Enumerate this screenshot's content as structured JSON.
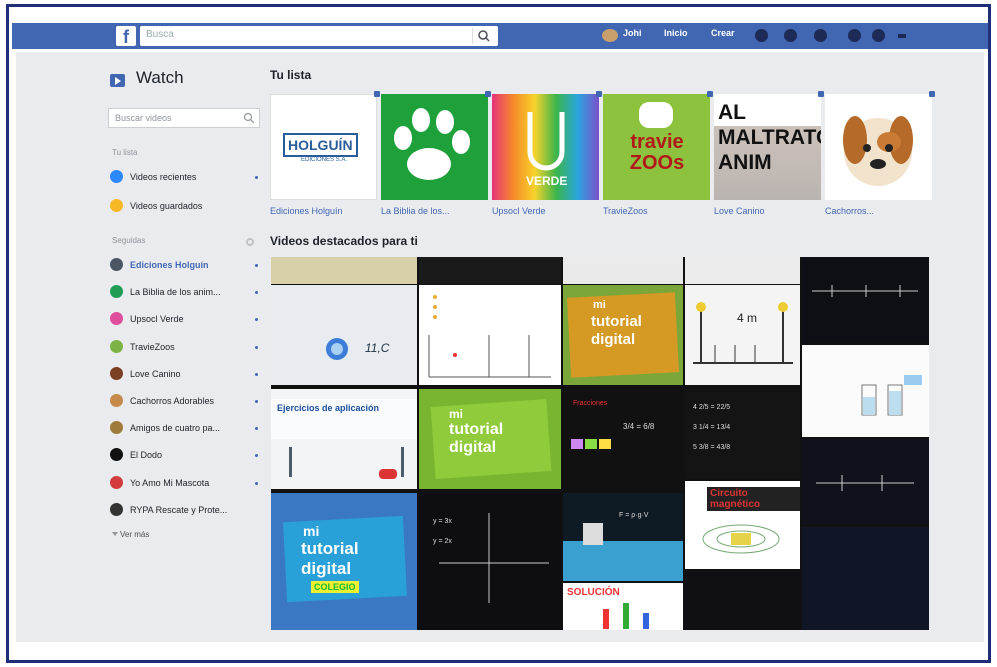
{
  "topbar": {
    "logo": "f",
    "search_placeholder": "Busca",
    "user": "Johi",
    "home": "Inicio",
    "create": "Crear"
  },
  "sidebar": {
    "title": "Watch",
    "search_placeholder": "Buscar videos",
    "tu_lista_label": "Tu lista",
    "tu_lista_items": [
      {
        "label": "Videos recientes",
        "color": "#2d88ff"
      },
      {
        "label": "Videos guardados",
        "color": "#f7b928"
      }
    ],
    "seguidas_label": "Seguidas",
    "followed": [
      {
        "label": "Ediciones Holguín",
        "color": "#4b5563",
        "selected": true
      },
      {
        "label": "La Biblia de los anim...",
        "color": "#1f9d55"
      },
      {
        "label": "Upsocl Verde",
        "color": "#e04f9b"
      },
      {
        "label": "TravieZoos",
        "color": "#7cb342"
      },
      {
        "label": "Love Canino",
        "color": "#7b3f22"
      },
      {
        "label": "Cachorros Adorables",
        "color": "#c58a4a"
      },
      {
        "label": "Amigos de cuatro pa...",
        "color": "#a07a3a"
      },
      {
        "label": "El Dodo",
        "color": "#111111"
      },
      {
        "label": "Yo Amo Mi Mascota",
        "color": "#d23c3c"
      },
      {
        "label": "RYPA Rescate y Prote...",
        "color": "#333333"
      }
    ],
    "more": "Ver más"
  },
  "main": {
    "list_title": "Tu lista",
    "channels": [
      {
        "label": "Ediciones Holguín",
        "logo_text": "HOLGUÍN",
        "sub_text": "EDICIONES S.A.",
        "bg": "#ffffff"
      },
      {
        "label": "La Biblia de los...",
        "logo_text": "",
        "bg": "#1ea03a"
      },
      {
        "label": "Upsocl Verde",
        "logo_text": "VERDE",
        "bg": "#f58a2a"
      },
      {
        "label": "TravieZoos",
        "logo_text": "travie ZOOs",
        "bg": "#8dc23f"
      },
      {
        "label": "Love Canino",
        "logo_text": "AL MALTRATO ANIM",
        "bg": "#ffffff"
      },
      {
        "label": "Cachorros...",
        "logo_text": "",
        "bg": "#ffffff"
      }
    ],
    "featured_title": "Videos destacados para ti",
    "featured_texts": {
      "temp": "11,C",
      "four_m": "4 m",
      "aplic": "Ejercicios de aplicación",
      "circuito": "Circuito magnético",
      "solucion": "SOLUCIÓN",
      "tutorial_1": "mi",
      "tutorial_2": "tutorial",
      "tutorial_3": "digital",
      "tutorial_4": "COLEGIO"
    }
  }
}
